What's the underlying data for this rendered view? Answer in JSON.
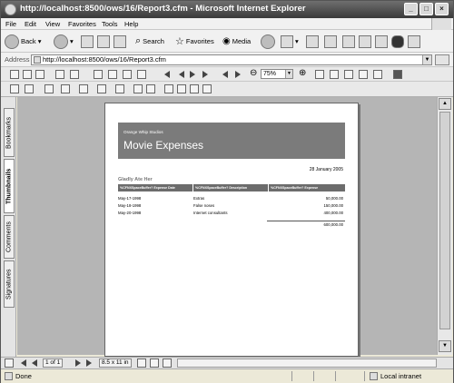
{
  "window": {
    "title": "http://localhost:8500/ows/16/Report3.cfm - Microsoft Internet Explorer",
    "minimize": "_",
    "maximize": "□",
    "close": "×"
  },
  "menu": [
    "File",
    "Edit",
    "View",
    "Favorites",
    "Tools",
    "Help"
  ],
  "toolbar": {
    "back": "Back",
    "search": "Search",
    "favorites": "Favorites",
    "media": "Media"
  },
  "address": {
    "label": "Address",
    "url": "http://localhost:8500/ows/16/Report3.cfm"
  },
  "pdf_toolbar": {
    "zoom": "75%"
  },
  "nav_tabs": [
    "Bookmarks",
    "Thumbnails",
    "Comments",
    "Signatures"
  ],
  "report": {
    "company": "Orange Whip Studios",
    "title": "Movie Expenses",
    "date": "28 January 2005",
    "group": "Gladly Ate Her",
    "columns": [
      "%CFNXSpaceBuffer?  Expense Date",
      "%CFNXSpaceBuffer?  Description",
      "%CFNXSpaceBuffer?  Expense"
    ],
    "rows": [
      {
        "date": "May-17-1998",
        "desc": "Extras",
        "amount": "50,000.00"
      },
      {
        "date": "May-18-1998",
        "desc": "False noses",
        "amount": "150,000.00"
      },
      {
        "date": "May-20-1998",
        "desc": "Internet consultants",
        "amount": "400,000.00"
      }
    ],
    "total": "600,000.00"
  },
  "bottom_bar": {
    "page": "1 of 1",
    "page_size": "8.5 x 11 in"
  },
  "status": {
    "text": "Done",
    "zone": "Local intranet"
  }
}
